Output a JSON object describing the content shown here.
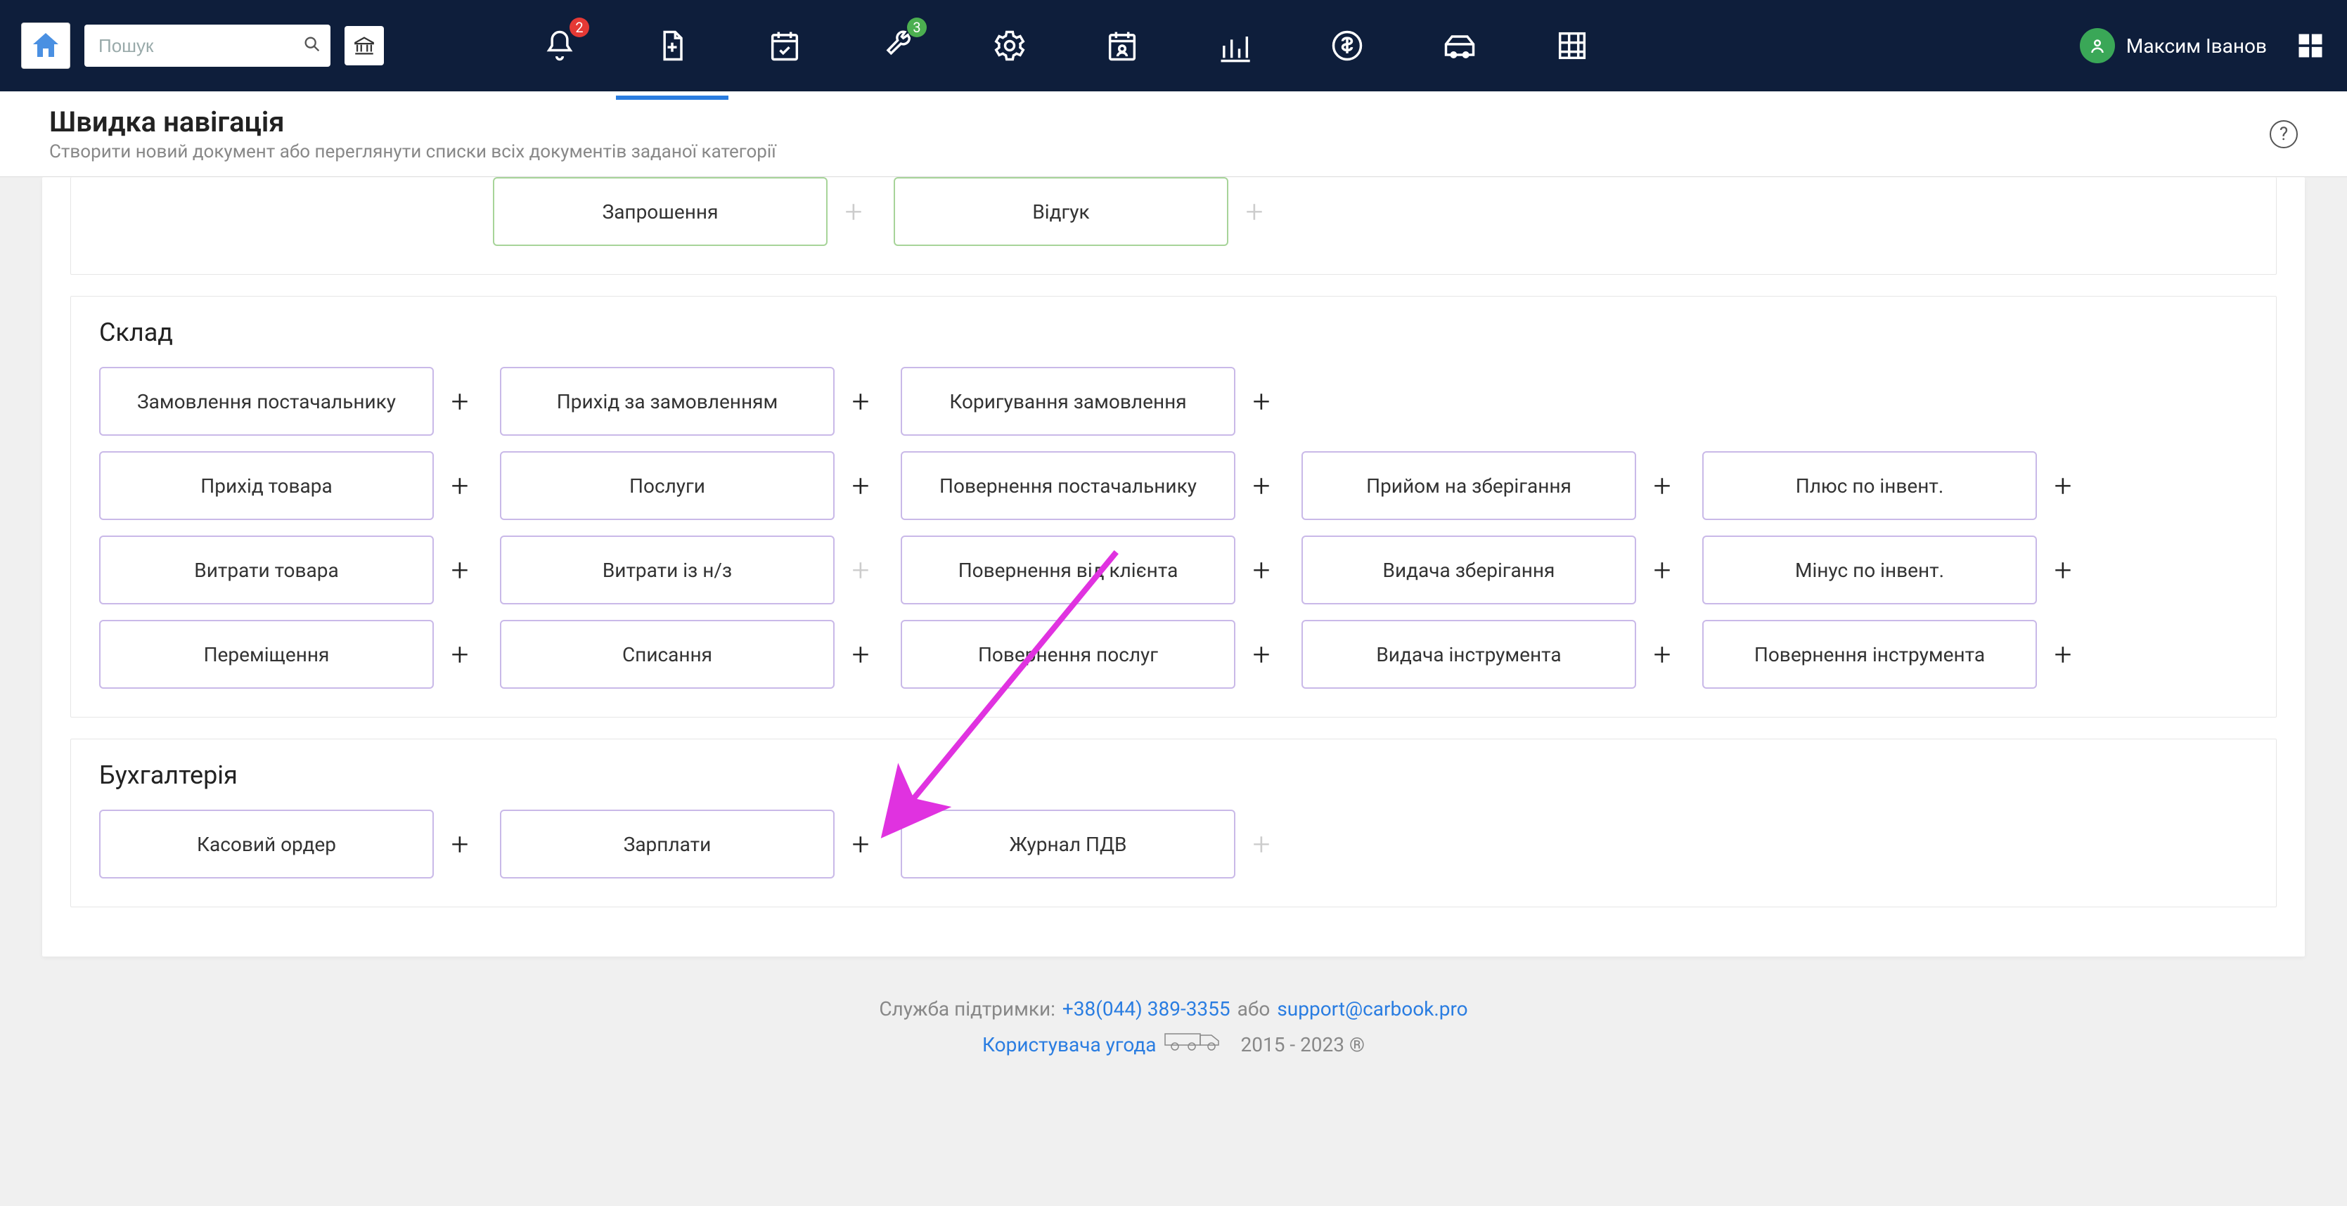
{
  "topbar": {
    "search_placeholder": "Пошук",
    "bell_badge": "2",
    "wrench_badge": "3",
    "user_name": "Максим Іванов"
  },
  "page": {
    "title": "Швидка навігація",
    "subtitle": "Створити новий документ або переглянути списки всіх документів заданої категорії"
  },
  "sections": {
    "top_row": {
      "invite": "Запрошення",
      "review": "Відгук"
    },
    "warehouse": {
      "title": "Склад",
      "r1c1": "Замовлення постачальнику",
      "r1c2": "Прихід за замовленням",
      "r1c3": "Коригування замовлення",
      "r2c1": "Прихід товара",
      "r2c2": "Послуги",
      "r2c3": "Повернення постачальнику",
      "r2c4": "Прийом на зберігання",
      "r2c5": "Плюс по інвент.",
      "r3c1": "Витрати товара",
      "r3c2": "Витрати із н/з",
      "r3c3": "Повернення від клієнта",
      "r3c4": "Видача зберігання",
      "r3c5": "Мінус по інвент.",
      "r4c1": "Переміщення",
      "r4c2": "Списання",
      "r4c3": "Повернення послуг",
      "r4c4": "Видача інструмента",
      "r4c5": "Повернення інструмента"
    },
    "accounting": {
      "title": "Бухгалтерія",
      "r1c1": "Касовий ордер",
      "r1c2": "Зарплати",
      "r1c3": "Журнал ПДВ"
    }
  },
  "footer": {
    "support_label": "Служба підтримки: ",
    "phone": "+38(044) 389-3355",
    "or": " або ",
    "email": "support@carbook.pro",
    "agreement": "Користувача угода",
    "years": "2015 - 2023 ®"
  }
}
